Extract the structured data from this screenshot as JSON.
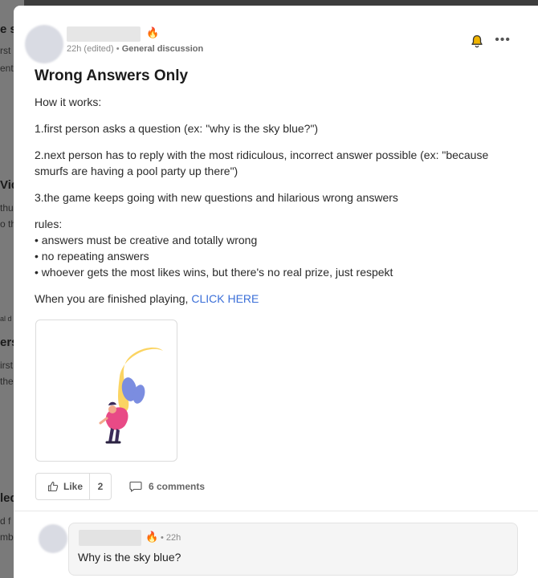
{
  "background_feed": {
    "fragments": [
      "e s",
      "rst",
      "ent",
      "Vid",
      "thu",
      "o th",
      "al d",
      "ers",
      "irst",
      "the",
      "led",
      "d f",
      "mb"
    ]
  },
  "post": {
    "timestamp": "22h (edited)",
    "separator": "•",
    "category": "General discussion",
    "author_badge_icon": "fire-icon",
    "title": "Wrong Answers Only",
    "intro": "How it works:",
    "step1": "1.first person asks a question (ex: \"why is the sky blue?\")",
    "step2": "2.next person has to reply with the most ridiculous, incorrect answer possible (ex: \"because smurfs are having a pool party up there\")",
    "step3": "3.the game keeps going with new questions and hilarious wrong answers",
    "rules_heading": "rules:",
    "rules": [
      "• answers must be creative and totally wrong",
      "• no repeating answers",
      "• whoever gets the most likes wins, but there's no real prize, just respekt"
    ],
    "finish_text": "When you are finished playing, ",
    "finish_link": "CLICK HERE",
    "like_label": "Like",
    "like_count": "2",
    "comments_label": "6 comments"
  },
  "comment": {
    "time": "• 22h",
    "text": "Why is the sky blue?"
  },
  "colors": {
    "link": "#3b6fd8",
    "flame": "#f26b1d",
    "bell": "#f0b400"
  }
}
